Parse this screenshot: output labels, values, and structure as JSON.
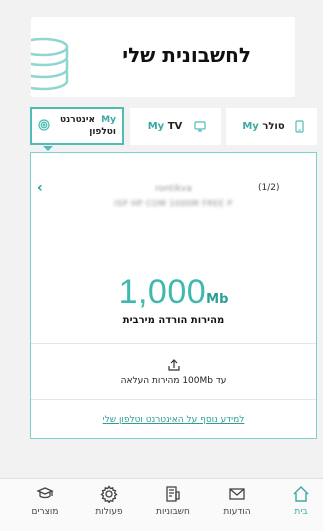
{
  "header": {
    "title": "לחשבונית שלי"
  },
  "tabs": [
    {
      "my": "My",
      "label": "אינטרנט\nוטלפון",
      "icon": "wifi-icon",
      "active": true
    },
    {
      "my": "My",
      "label": "TV",
      "icon": "tv-icon",
      "active": false
    },
    {
      "my": "My",
      "label": "סולר",
      "icon": "phone-icon",
      "active": false
    }
  ],
  "account": {
    "pager": "(1/2)",
    "name": "rontikva",
    "id": "ISP HP COM 1000M FREE P"
  },
  "speed": {
    "value": "1,000",
    "unit": "Mb",
    "label": "מהירות הורדה מירבית"
  },
  "upload": {
    "label": "עד 100Mb מהירות העלאה",
    "icon": "upload-icon"
  },
  "info_link": "למידע נוסף על האינטרנט וטלפון שלי",
  "bottom_nav": [
    {
      "label": "בית",
      "icon": "home-icon",
      "active": true
    },
    {
      "label": "הודעות",
      "icon": "envelope-icon",
      "active": false
    },
    {
      "label": "חשבוניות",
      "icon": "invoice-icon",
      "active": false
    },
    {
      "label": "פעולות",
      "icon": "gear-icon",
      "active": false
    },
    {
      "label": "מוצרים",
      "icon": "products-icon",
      "active": false
    }
  ],
  "colors": {
    "accent": "#3fb8ae",
    "accent_dark": "#2e9d95",
    "background": "#f2f2f2"
  }
}
